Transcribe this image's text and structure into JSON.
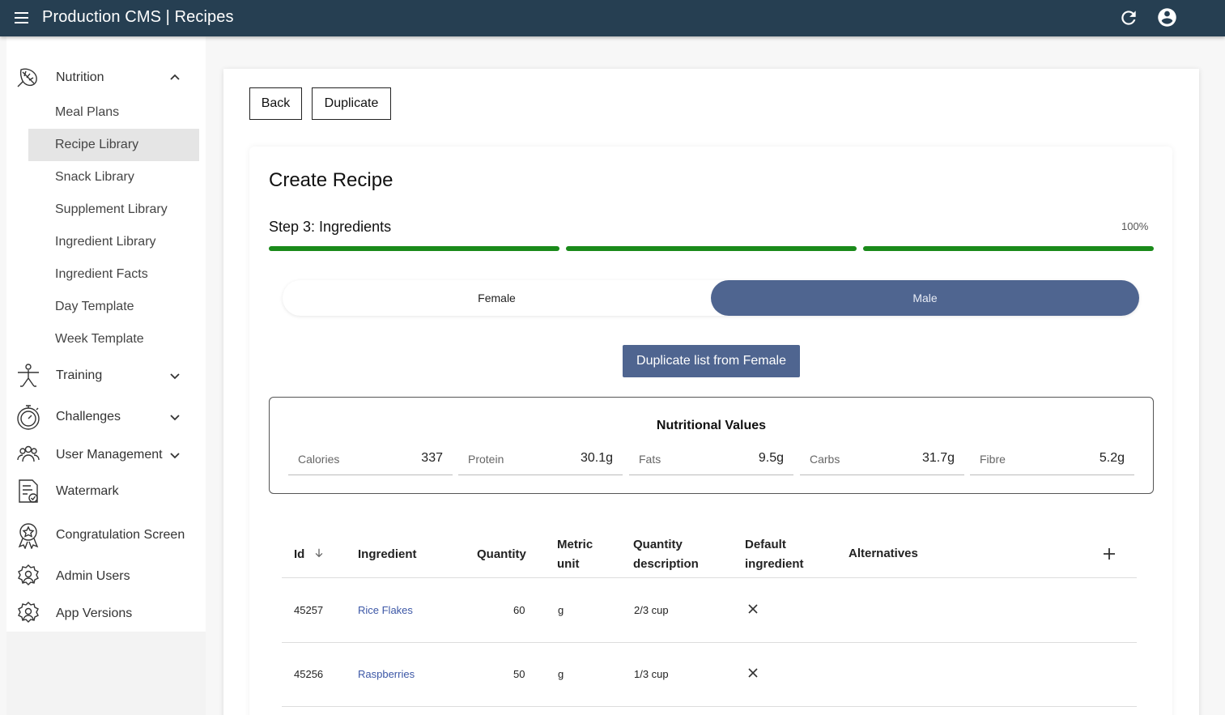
{
  "header": {
    "title": "Production CMS | Recipes"
  },
  "sidebar": {
    "nutrition": {
      "label": "Nutrition"
    },
    "nutrition_items": [
      {
        "label": "Meal Plans"
      },
      {
        "label": "Recipe Library"
      },
      {
        "label": "Snack Library"
      },
      {
        "label": "Supplement Library"
      },
      {
        "label": "Ingredient Library"
      },
      {
        "label": "Ingredient Facts"
      },
      {
        "label": "Day Template"
      },
      {
        "label": "Week Template"
      }
    ],
    "groups": [
      {
        "label": "Training"
      },
      {
        "label": "Challenges"
      },
      {
        "label": "User Management"
      },
      {
        "label": "Watermark"
      },
      {
        "label": "Congratulation Screen"
      },
      {
        "label": "Admin Users"
      },
      {
        "label": "App Versions"
      }
    ]
  },
  "actions": {
    "back": "Back",
    "duplicate": "Duplicate"
  },
  "form": {
    "title": "Create Recipe",
    "step": "Step 3: Ingredients",
    "progress_text": "100%",
    "progress": 1.0,
    "gender_options": {
      "female": "Female",
      "male": "Male"
    },
    "selected_gender": "Male",
    "duplicate_list_button": "Duplicate list from Female"
  },
  "nutrition": {
    "title": "Nutritional Values",
    "fields": [
      {
        "label": "Calories",
        "value": "337"
      },
      {
        "label": "Protein",
        "value": "30.1g"
      },
      {
        "label": "Fats",
        "value": "9.5g"
      },
      {
        "label": "Carbs",
        "value": "31.7g"
      },
      {
        "label": "Fibre",
        "value": "5.2g"
      }
    ]
  },
  "table": {
    "headers": {
      "id": "Id",
      "ingredient": "Ingredient",
      "quantity": "Quantity",
      "metric_unit_1": "Metric",
      "metric_unit_2": "unit",
      "qty_desc_1": "Quantity",
      "qty_desc_2": "description",
      "default_1": "Default",
      "default_2": "ingredient",
      "alternatives": "Alternatives"
    },
    "rows": [
      {
        "id": "45257",
        "ingredient": "Rice Flakes",
        "quantity": "60",
        "unit": "g",
        "description": "2/3 cup",
        "default": false
      },
      {
        "id": "45256",
        "ingredient": "Raspberries",
        "quantity": "50",
        "unit": "g",
        "description": "1/3 cup",
        "default": false
      }
    ]
  },
  "colors": {
    "topbar": "#263f52",
    "accent": "#4f6590",
    "progress": "#1a8a1a",
    "link": "#3c57a6"
  }
}
